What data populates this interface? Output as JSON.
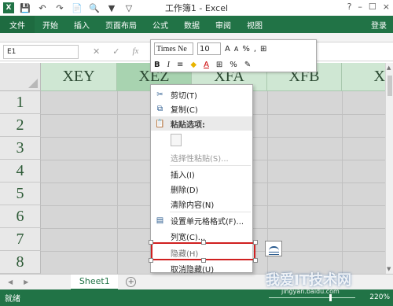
{
  "titlebar": {
    "app_icon": "X",
    "title": "工作簿1 - Excel",
    "icons": [
      "save-icon",
      "undo-icon",
      "redo-icon",
      "new-icon",
      "print-preview-icon",
      "filter-icon",
      "clear-filter-icon"
    ],
    "right_controls": [
      "?",
      "–",
      "☐",
      "×"
    ]
  },
  "ribbon": {
    "tabs": [
      "文件",
      "开始",
      "插入",
      "页面布局",
      "公式",
      "数据",
      "审阅",
      "视图"
    ],
    "login": "登录"
  },
  "formula_bar": {
    "name_box": "E1",
    "cancel": "✕",
    "enter": "✓",
    "fx": "fx"
  },
  "grid": {
    "columns": [
      "XEY",
      "XEZ",
      "XFA",
      "XFB",
      "X"
    ],
    "rows": [
      "1",
      "2",
      "3",
      "4",
      "5",
      "6",
      "7",
      "8"
    ]
  },
  "minibar": {
    "font": "Times Ne",
    "size": "10",
    "row1": [
      "A",
      "A",
      "%",
      ",",
      "⊞"
    ],
    "row2": [
      "B",
      "I",
      "≡",
      "A",
      "%"
    ]
  },
  "context_menu": {
    "items": [
      {
        "label": "剪切(T)",
        "icon": "scissors-icon"
      },
      {
        "label": "复制(C)",
        "icon": "copy-icon"
      },
      {
        "label": "粘贴选项:",
        "icon": "paste-icon"
      },
      {
        "label": "选择性粘贴(S)...",
        "icon": ""
      },
      {
        "label": "插入(I)",
        "icon": ""
      },
      {
        "label": "删除(D)",
        "icon": ""
      },
      {
        "label": "清除内容(N)",
        "icon": ""
      },
      {
        "label": "设置单元格格式(F)...",
        "icon": "format-cells-icon"
      },
      {
        "label": "列宽(C)...",
        "icon": ""
      },
      {
        "label": "隐藏(H)",
        "icon": ""
      },
      {
        "label": "取消隐藏(U)",
        "icon": ""
      }
    ]
  },
  "sheets": {
    "active": "Sheet1",
    "add": "+"
  },
  "statusbar": {
    "ready": "就绪",
    "zoom": "220%"
  },
  "watermark": {
    "text": "我爱IT技术网",
    "url": "jingyan.baidu.com"
  },
  "colors": {
    "excel_green": "#217346",
    "selected_col": "#a8d3b0",
    "highlight_red": "#d02020"
  }
}
